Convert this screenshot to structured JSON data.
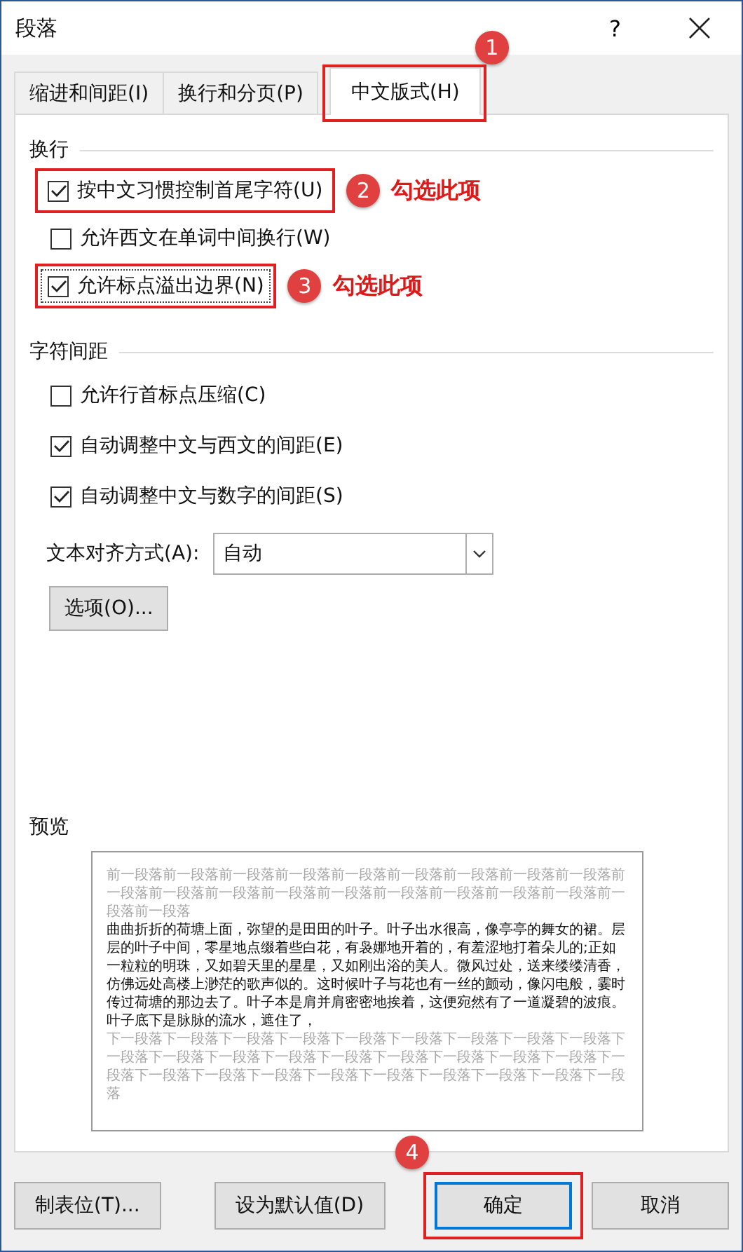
{
  "window": {
    "title": "段落",
    "help": "?"
  },
  "tabs": [
    {
      "label": "缩进和间距(I)",
      "selected": false
    },
    {
      "label": "换行和分页(P)",
      "selected": false
    },
    {
      "label": "中文版式(H)",
      "selected": true,
      "annotation": {
        "number": "1"
      }
    }
  ],
  "groups": [
    {
      "title": "换行",
      "options": [
        {
          "label": "按中文习惯控制首尾字符(U)",
          "checked": true,
          "annotation": {
            "number": "2",
            "note": "勾选此项"
          }
        },
        {
          "label": "允许西文在单词中间换行(W)",
          "checked": false
        },
        {
          "label": "允许标点溢出边界(N)",
          "checked": true,
          "focused": true,
          "annotation": {
            "number": "3",
            "note": "勾选此项"
          }
        }
      ]
    },
    {
      "title": "字符间距",
      "options": [
        {
          "label": "允许行首标点压缩(C)",
          "checked": false
        },
        {
          "label": "自动调整中文与西文的间距(E)",
          "checked": true
        },
        {
          "label": "自动调整中文与数字的间距(S)",
          "checked": true
        }
      ],
      "alignment": {
        "label": "文本对齐方式(A):",
        "value": "自动"
      },
      "options_button": "选项(O)..."
    }
  ],
  "preview": {
    "title": "预览",
    "before": "前一段落前一段落前一段落前一段落前一段落前一段落前一段落前一段落前一段落前一段落前一段落前一段落前一段落前一段落前一段落前一段落前一段落前一段落前一段落前一段落",
    "sample": "曲曲折折的荷塘上面，弥望的是田田的叶子。叶子出水很高，像亭亭的舞女的裙。层层的叶子中间，零星地点缀着些白花，有袅娜地开着的，有羞涩地打着朵儿的;正如一粒粒的明珠，又如碧天里的星星，又如刚出浴的美人。微风过处，送来缕缕清香，仿佛远处高楼上渺茫的歌声似的。这时候叶子与花也有一丝的颤动，像闪电般，霎时传过荷塘的那边去了。叶子本是肩并肩密密地挨着，这便宛然有了一道凝碧的波痕。叶子底下是脉脉的流水，遮住了，",
    "after": "下一段落下一段落下一段落下一段落下一段落下一段落下一段落下一段落下一段落下一段落下一段落下一段落下一段落下一段落下一段落下一段落下一段落下一段落下一段落下一段落下一段落下一段落下一段落下一段落下一段落下一段落下一段落下一段落"
  },
  "buttons": [
    {
      "label": "制表位(T)...",
      "default": false
    },
    {
      "label": "设为默认值(D)",
      "default": false
    },
    {
      "label": "确定",
      "default": true,
      "annotation": {
        "number": "4"
      }
    },
    {
      "label": "取消",
      "default": false
    }
  ]
}
